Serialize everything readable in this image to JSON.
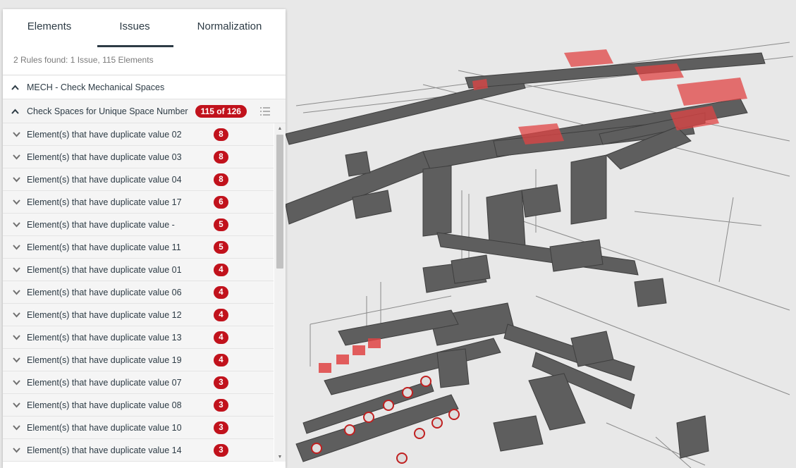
{
  "tabs": [
    {
      "label": "Elements",
      "active": false
    },
    {
      "label": "Issues",
      "active": true
    },
    {
      "label": "Normalization",
      "active": false
    }
  ],
  "summary": "2 Rules found: 1 Issue, 115 Elements",
  "rule_group": {
    "label": "MECH - Check Mechanical Spaces",
    "state": "expanded"
  },
  "rule": {
    "label": "Check Spaces for Unique Space Number",
    "badge": "115 of 126",
    "menu_icon": "list-icon"
  },
  "elements": [
    {
      "label": "Element(s) that have duplicate value 02",
      "count": "8"
    },
    {
      "label": "Element(s) that have duplicate value 03",
      "count": "8"
    },
    {
      "label": "Element(s) that have duplicate value 04",
      "count": "8"
    },
    {
      "label": "Element(s) that have duplicate value 17",
      "count": "6"
    },
    {
      "label": "Element(s) that have duplicate value -",
      "count": "5"
    },
    {
      "label": "Element(s) that have duplicate value 11",
      "count": "5"
    },
    {
      "label": "Element(s) that have duplicate value 01",
      "count": "4"
    },
    {
      "label": "Element(s) that have duplicate value 06",
      "count": "4"
    },
    {
      "label": "Element(s) that have duplicate value 12",
      "count": "4"
    },
    {
      "label": "Element(s) that have duplicate value 13",
      "count": "4"
    },
    {
      "label": "Element(s) that have duplicate value 19",
      "count": "4"
    },
    {
      "label": "Element(s) that have duplicate value 07",
      "count": "3"
    },
    {
      "label": "Element(s) that have duplicate value 08",
      "count": "3"
    },
    {
      "label": "Element(s) that have duplicate value 10",
      "count": "3"
    },
    {
      "label": "Element(s) that have duplicate value 14",
      "count": "3"
    }
  ],
  "colors": {
    "accent": "#c1121c",
    "text": "#2d3b45",
    "highlight": "#e04444",
    "duct": "#5a5a5a"
  },
  "viewport": {
    "content": "3D mechanical ductwork model with highlighted spaces"
  }
}
